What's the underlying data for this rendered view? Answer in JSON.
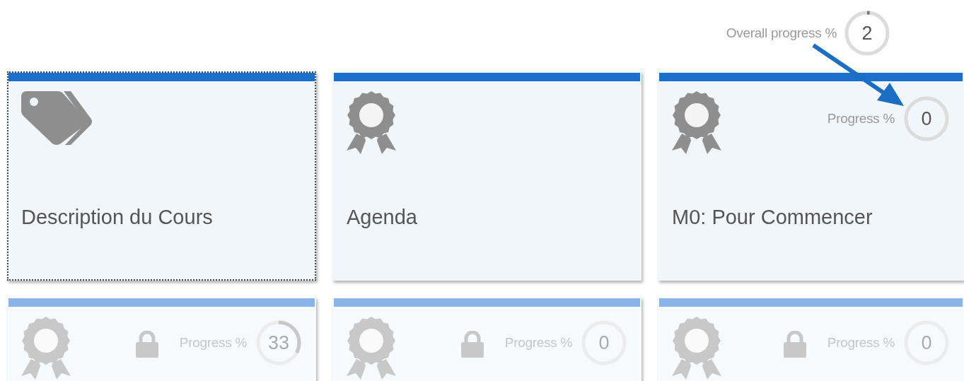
{
  "overall_progress": {
    "label": "Overall progress %",
    "value": "2",
    "level": 0.02
  },
  "annotation": {
    "kind": "arrow"
  },
  "cards": [
    {
      "kind": "tag",
      "title": "Description du Cours",
      "focused": true,
      "locked": false
    },
    {
      "kind": "award",
      "title": "Agenda",
      "focused": false,
      "locked": false
    },
    {
      "kind": "award",
      "title": "M0: Pour Commencer",
      "focused": false,
      "locked": false,
      "progress": {
        "label": "Progress %",
        "value": "0",
        "level": 0
      }
    },
    {
      "kind": "award",
      "focused": false,
      "locked": true,
      "progress": {
        "label": "Progress %",
        "value": "33",
        "level": 0.33
      }
    },
    {
      "kind": "award",
      "focused": false,
      "locked": true,
      "progress": {
        "label": "Progress %",
        "value": "0",
        "level": 0
      }
    },
    {
      "kind": "award",
      "focused": false,
      "locked": true,
      "progress": {
        "label": "Progress %",
        "value": "0",
        "level": 0
      }
    }
  ]
}
